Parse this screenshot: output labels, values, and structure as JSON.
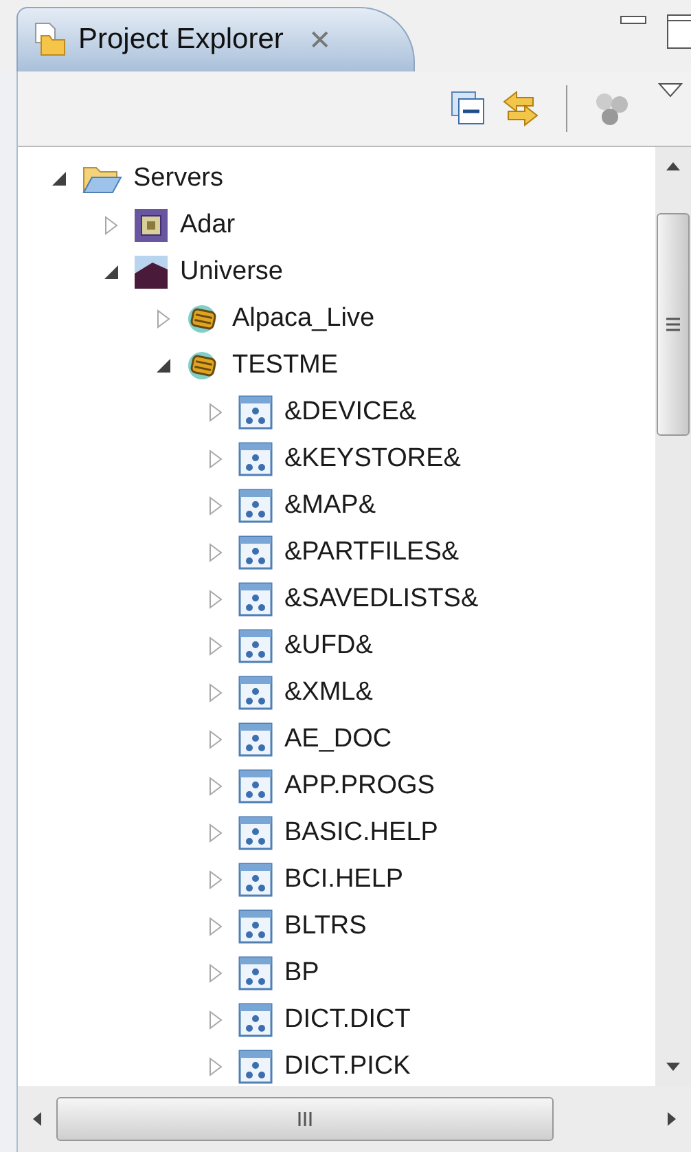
{
  "view": {
    "title": "Project Explorer",
    "close": "✕"
  },
  "tree": [
    {
      "label": "Servers",
      "kind": "folder",
      "expanded": true,
      "children": [
        {
          "label": "Adar",
          "kind": "chip",
          "expanded": false
        },
        {
          "label": "Universe",
          "kind": "picture",
          "expanded": true,
          "children": [
            {
              "label": "Alpaca_Live",
              "kind": "database",
              "expanded": false
            },
            {
              "label": "TESTME",
              "kind": "database",
              "expanded": true,
              "children": [
                {
                  "label": "&DEVICE&",
                  "kind": "file",
                  "expanded": false
                },
                {
                  "label": "&KEYSTORE&",
                  "kind": "file",
                  "expanded": false
                },
                {
                  "label": "&MAP&",
                  "kind": "file",
                  "expanded": false
                },
                {
                  "label": "&PARTFILES&",
                  "kind": "file",
                  "expanded": false
                },
                {
                  "label": "&SAVEDLISTS&",
                  "kind": "file",
                  "expanded": false
                },
                {
                  "label": "&UFD&",
                  "kind": "file",
                  "expanded": false
                },
                {
                  "label": "&XML&",
                  "kind": "file",
                  "expanded": false
                },
                {
                  "label": "AE_DOC",
                  "kind": "file",
                  "expanded": false
                },
                {
                  "label": "APP.PROGS",
                  "kind": "file",
                  "expanded": false
                },
                {
                  "label": "BASIC.HELP",
                  "kind": "file",
                  "expanded": false
                },
                {
                  "label": "BCI.HELP",
                  "kind": "file",
                  "expanded": false
                },
                {
                  "label": "BLTRS",
                  "kind": "file",
                  "expanded": false
                },
                {
                  "label": "BP",
                  "kind": "file",
                  "expanded": false
                },
                {
                  "label": "DICT.DICT",
                  "kind": "file",
                  "expanded": false
                },
                {
                  "label": "DICT.PICK",
                  "kind": "file",
                  "expanded": false
                }
              ]
            }
          ]
        }
      ]
    }
  ]
}
